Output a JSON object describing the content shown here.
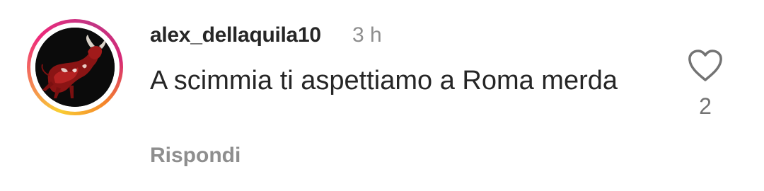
{
  "comment": {
    "username": "alex_dellaquila10",
    "time_ago": "3 h",
    "text": "A scimmia ti aspettiamo a Roma merda",
    "reply_label": "Rispondi",
    "like_count": "2",
    "avatar_icon": "bull-profile-picture",
    "like_icon": "heart-outline-icon"
  },
  "colors": {
    "text": "#262626",
    "secondary_text": "#8e8e8e",
    "icon": "#737373",
    "story_ring_gradient": [
      "#f9ce34",
      "#ee2a7b",
      "#c13584",
      "#f58529"
    ]
  }
}
